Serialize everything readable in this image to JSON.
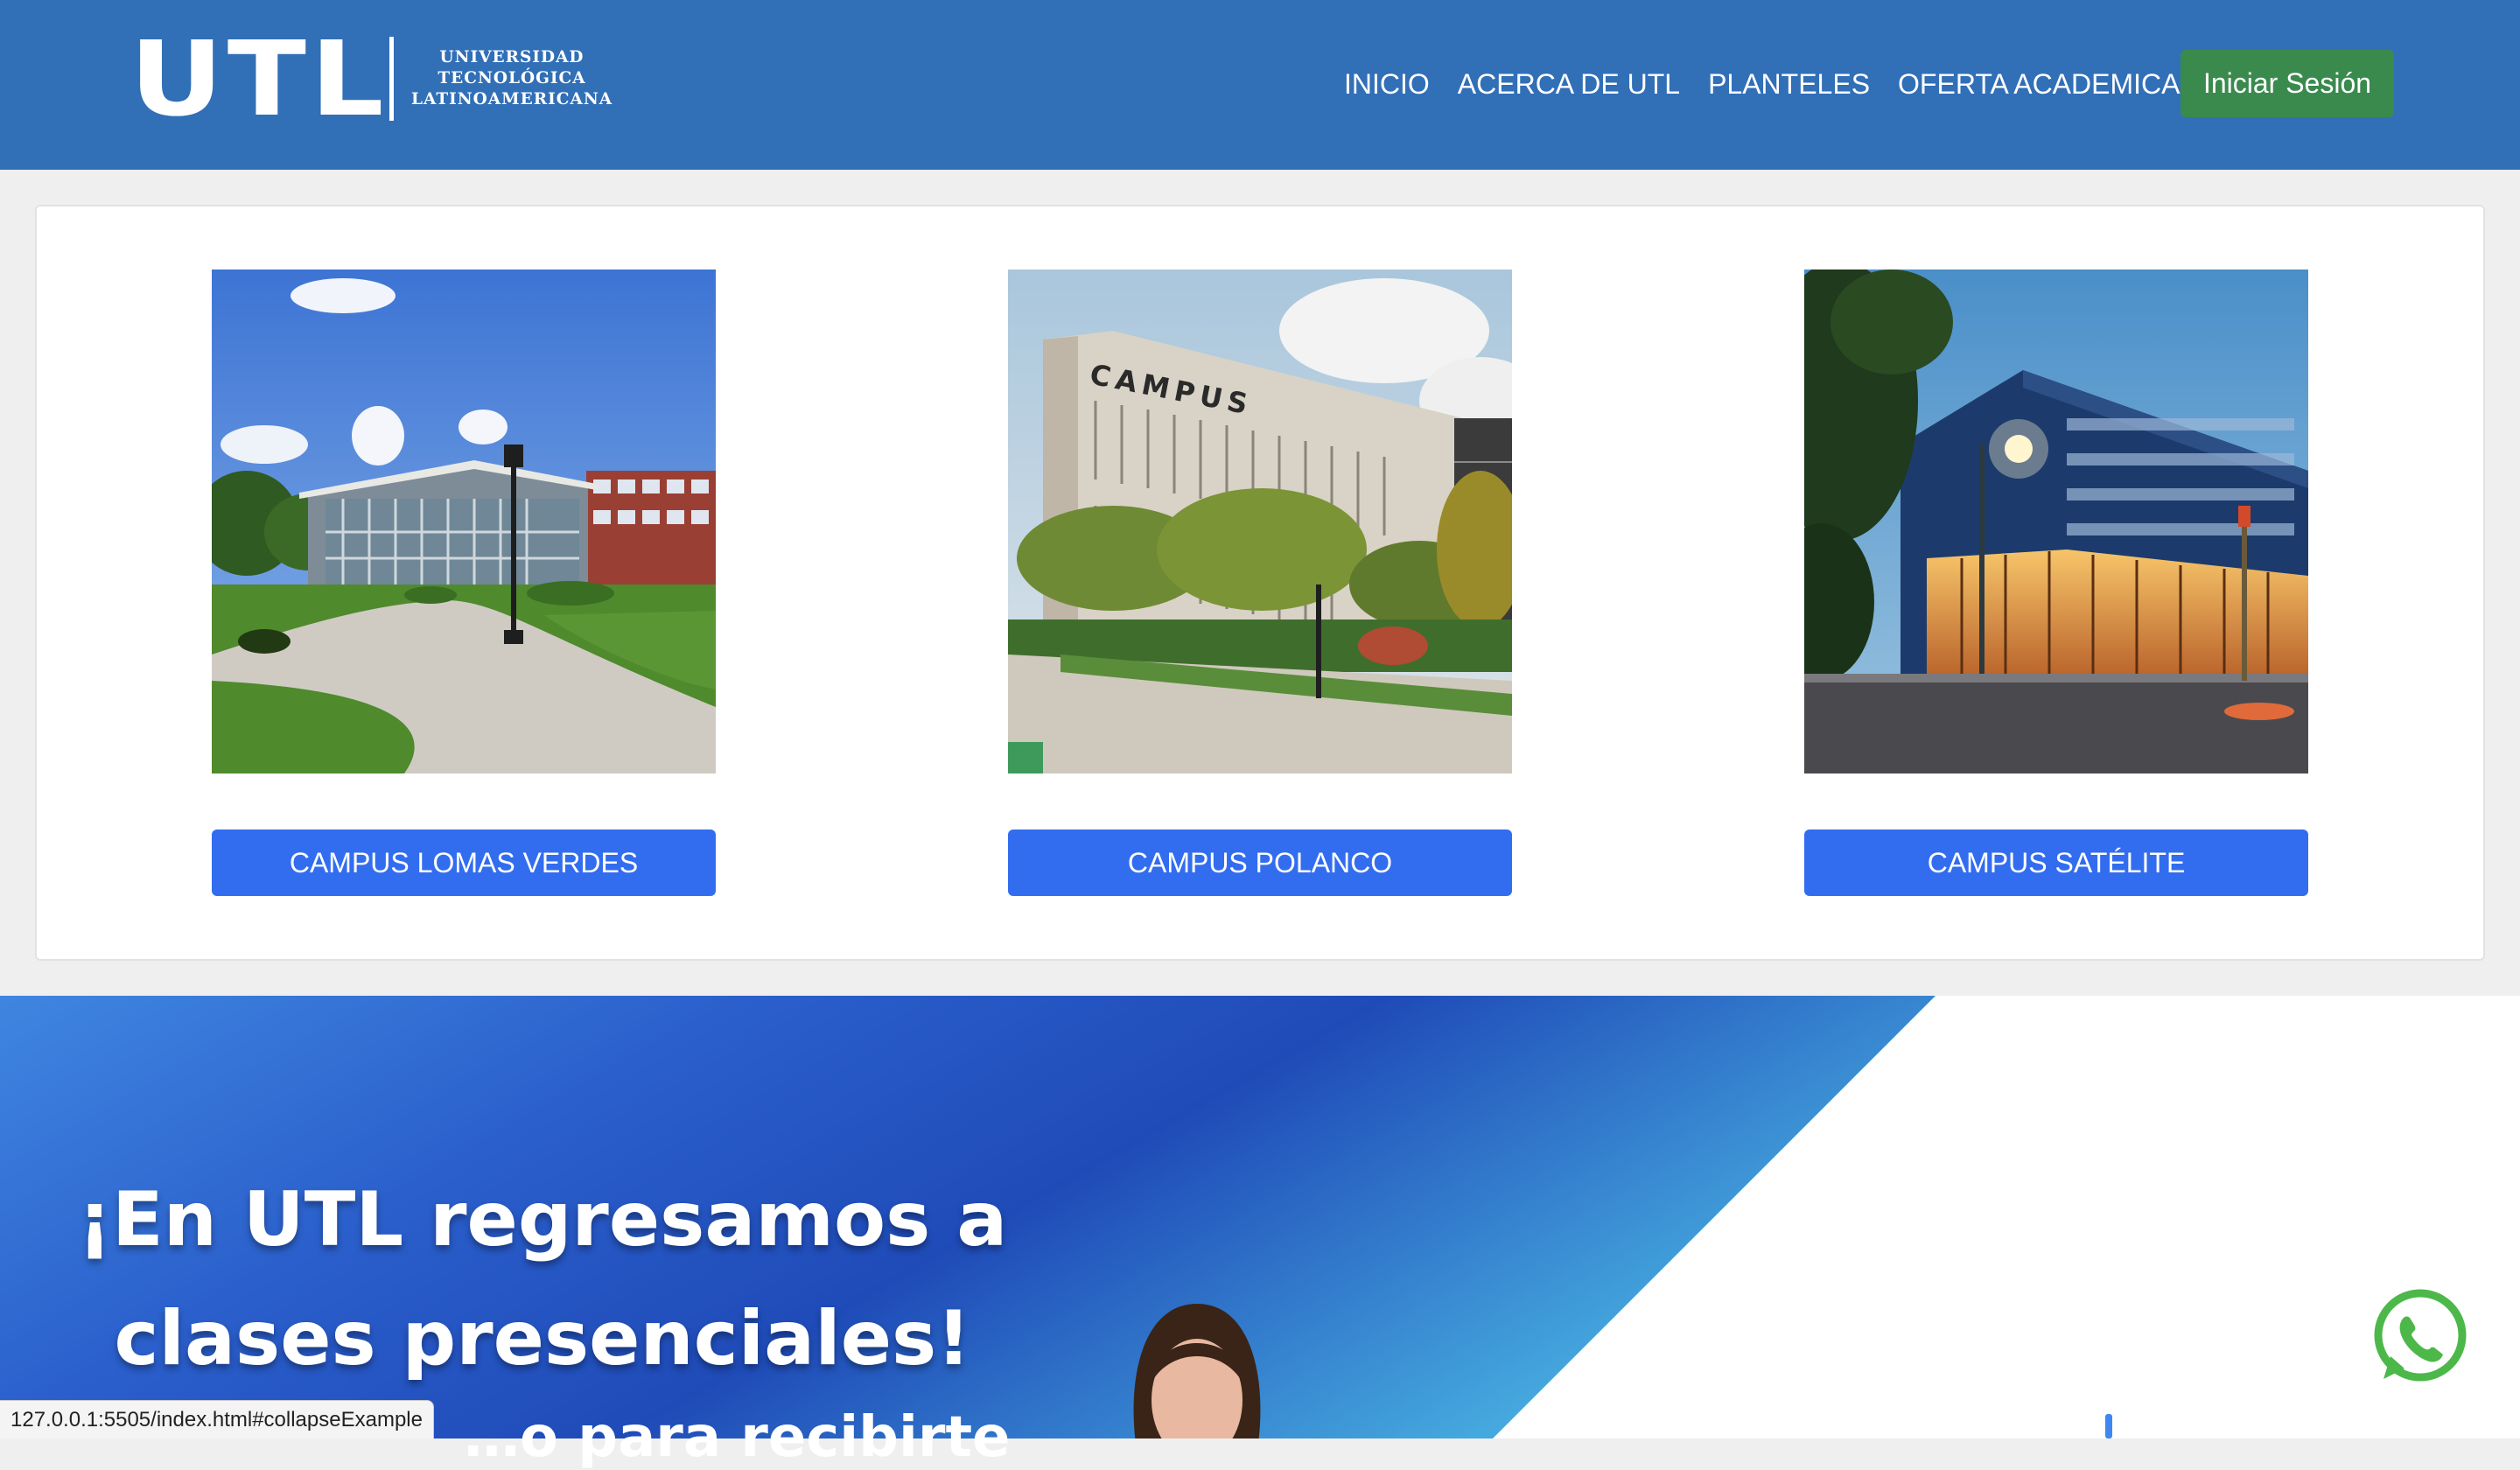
{
  "header": {
    "logo": {
      "mark": "UTL",
      "lines": [
        "UNIVERSIDAD",
        "TECNOLÓGICA",
        "LATINOAMERICANA"
      ]
    },
    "nav": [
      {
        "label": "INICIO"
      },
      {
        "label": "ACERCA DE UTL"
      },
      {
        "label": "PLANTELES"
      },
      {
        "label": "OFERTA ACADEMICA"
      }
    ],
    "login_label": "Iniciar Sesión"
  },
  "campuses": [
    {
      "label": "CAMPUS LOMAS VERDES",
      "photo": "campus-lomas-verdes-photo"
    },
    {
      "label": "CAMPUS POLANCO",
      "photo": "campus-polanco-photo"
    },
    {
      "label": "CAMPUS SATÉLITE",
      "photo": "campus-satelite-photo"
    }
  ],
  "photo_signs": {
    "polanco": "CAMPUS"
  },
  "hero": {
    "title_line1": "¡En UTL regresamos a",
    "title_line2": "clases presenciales!",
    "subtitle_partial": "…o para recibirte"
  },
  "status_bar_url": "127.0.0.1:5505/index.html#collapseExample",
  "colors": {
    "navbar": "#316fb7",
    "login_button": "#3a8a4e",
    "campus_button": "#326df0",
    "whatsapp": "#4cb84a"
  },
  "icons": {
    "whatsapp": "whatsapp-icon"
  }
}
